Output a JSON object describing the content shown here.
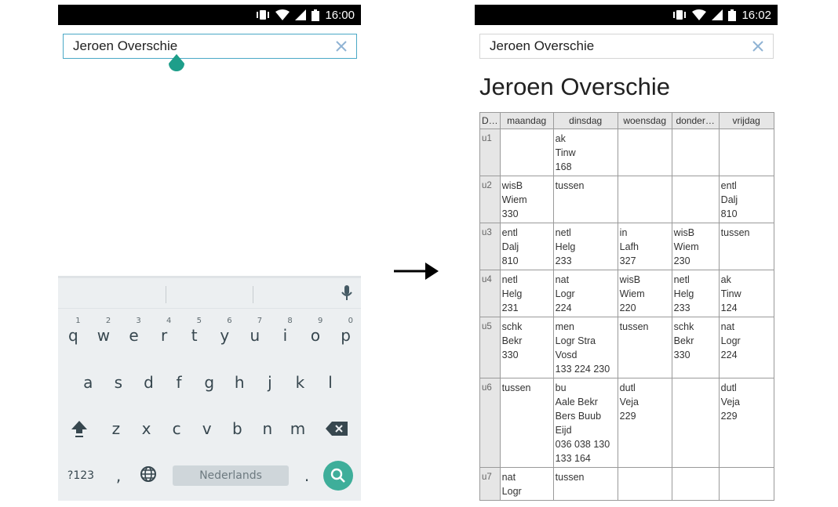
{
  "left_screen": {
    "status_time": "16:00",
    "search": {
      "value": "Jeroen Overschie"
    },
    "keyboard": {
      "row1": [
        {
          "key": "q",
          "hint": "1"
        },
        {
          "key": "w",
          "hint": "2"
        },
        {
          "key": "e",
          "hint": "3"
        },
        {
          "key": "r",
          "hint": "4"
        },
        {
          "key": "t",
          "hint": "5"
        },
        {
          "key": "y",
          "hint": "6"
        },
        {
          "key": "u",
          "hint": "7"
        },
        {
          "key": "i",
          "hint": "8"
        },
        {
          "key": "o",
          "hint": "9"
        },
        {
          "key": "p",
          "hint": "0"
        }
      ],
      "row2": [
        "a",
        "s",
        "d",
        "f",
        "g",
        "h",
        "j",
        "k",
        "l"
      ],
      "row3": [
        "z",
        "x",
        "c",
        "v",
        "b",
        "n",
        "m"
      ],
      "symbols_label": "?123",
      "comma_label": ",",
      "period_label": ".",
      "space_label": "Nederlands"
    }
  },
  "right_screen": {
    "status_time": "16:02",
    "search": {
      "value": "Jeroen Overschie"
    },
    "title": "Jeroen Overschie",
    "table": {
      "headers": [
        "D…",
        "maandag",
        "dinsdag",
        "woensdag",
        "donder…",
        "vrijdag"
      ],
      "rows": [
        {
          "hour": "u1",
          "cells": [
            "",
            "ak\nTinw\n168",
            "",
            "",
            ""
          ]
        },
        {
          "hour": "u2",
          "cells": [
            "wisB\nWiem\n330",
            "tussen",
            "",
            "",
            "entl\nDalj\n810"
          ]
        },
        {
          "hour": "u3",
          "cells": [
            "entl\nDalj\n810",
            "netl\nHelg\n233",
            "in\nLafh\n327",
            "wisB\nWiem\n230",
            "tussen"
          ]
        },
        {
          "hour": "u4",
          "cells": [
            "netl\nHelg\n231",
            "nat\nLogr\n224",
            "wisB\nWiem\n220",
            "netl\nHelg\n233",
            "ak\nTinw\n124"
          ]
        },
        {
          "hour": "u5",
          "cells": [
            "schk\nBekr\n330",
            "men\nLogr Stra\nVosd\n133 224 230",
            "tussen",
            "schk\nBekr\n330",
            "nat\nLogr\n224"
          ]
        },
        {
          "hour": "u6",
          "cells": [
            "tussen",
            "bu\nAale Bekr\nBers Buub\nEijd\n036 038 130\n133 164",
            "dutl\nVeja\n229",
            "",
            "dutl\nVeja\n229"
          ]
        },
        {
          "hour": "u7",
          "cells": [
            "nat\nLogr",
            "tussen",
            "",
            "",
            ""
          ]
        }
      ]
    }
  },
  "colors": {
    "accent": "#3eae9a",
    "statusbar": "#000000",
    "keyboard_bg": "#eceff1",
    "clear_icon": "#8fb3d4",
    "focus_border": "#4aa8c6"
  }
}
